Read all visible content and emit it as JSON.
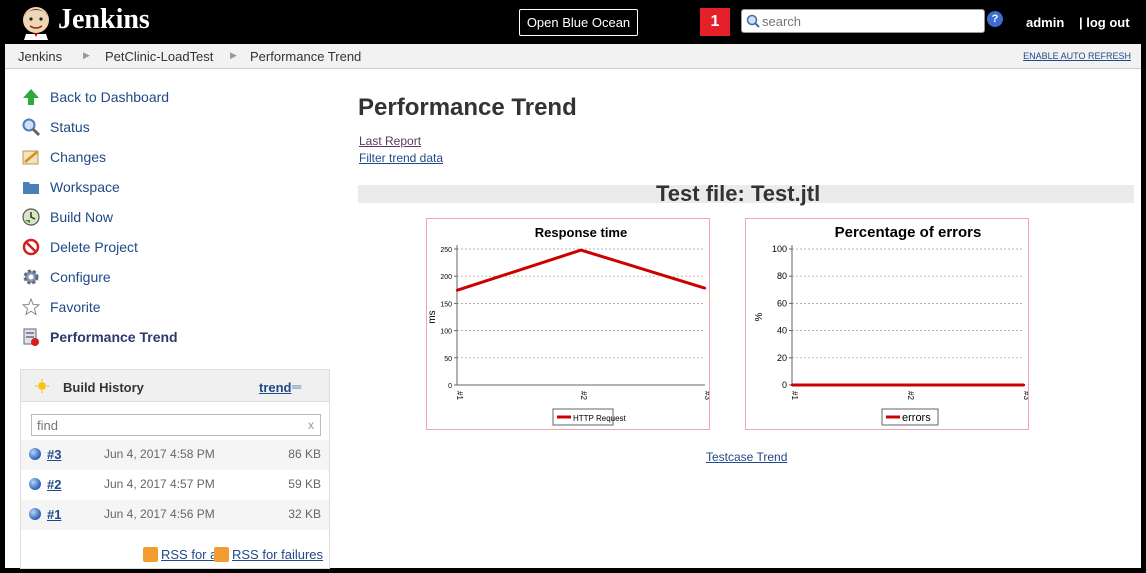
{
  "header": {
    "app_title": "Jenkins",
    "blue_ocean_label": "Open Blue Ocean",
    "notification_count": "1",
    "search_placeholder": "search",
    "help_icon": "?",
    "user": "admin",
    "logout": "| log out"
  },
  "breadcrumb": {
    "items": [
      "Jenkins",
      "PetClinic-LoadTest",
      "Performance Trend"
    ],
    "auto_refresh": "ENABLE AUTO REFRESH"
  },
  "sidebar": {
    "tasks": [
      {
        "label": "Back to Dashboard",
        "icon": "up-arrow-icon"
      },
      {
        "label": "Status",
        "icon": "magnifier-icon"
      },
      {
        "label": "Changes",
        "icon": "notepad-icon"
      },
      {
        "label": "Workspace",
        "icon": "folder-icon"
      },
      {
        "label": "Build Now",
        "icon": "clock-icon"
      },
      {
        "label": "Delete Project",
        "icon": "no-entry-icon"
      },
      {
        "label": "Configure",
        "icon": "gear-icon"
      },
      {
        "label": "Favorite",
        "icon": "star-icon"
      },
      {
        "label": "Performance Trend",
        "icon": "performance-icon"
      }
    ]
  },
  "build_history": {
    "title": "Build History",
    "trend_label": "trend",
    "trend_suffix": "═",
    "find_placeholder": "find",
    "clear": "x",
    "builds": [
      {
        "number": "#3",
        "date": "Jun 4, 2017 4:58 PM",
        "size": "86 KB"
      },
      {
        "number": "#2",
        "date": "Jun 4, 2017 4:57 PM",
        "size": "59 KB"
      },
      {
        "number": "#1",
        "date": "Jun 4, 2017 4:56 PM",
        "size": "32 KB"
      }
    ],
    "rss_all": "RSS for all",
    "rss_failures": "RSS for failures"
  },
  "main": {
    "title": "Performance Trend",
    "last_report": "Last Report",
    "filter_trend": "Filter trend data",
    "test_file": "Test file: Test.jtl",
    "testcase_trend": "Testcase Trend"
  },
  "chart_data": [
    {
      "type": "line",
      "title": "Response time",
      "xlabel": "",
      "ylabel": "ms",
      "categories": [
        "#1",
        "#2",
        "#3"
      ],
      "ylim": [
        0,
        250
      ],
      "yticks": [
        0,
        50,
        100,
        150,
        200,
        250
      ],
      "series": [
        {
          "name": "HTTP Request",
          "values": [
            174,
            248,
            178
          ],
          "color": "#cc0000"
        }
      ],
      "grid": true,
      "legend": "bottom"
    },
    {
      "type": "line",
      "title": "Percentage of errors",
      "xlabel": "",
      "ylabel": "%",
      "categories": [
        "#1",
        "#2",
        "#3"
      ],
      "ylim": [
        0,
        100
      ],
      "yticks": [
        0,
        20,
        40,
        60,
        80,
        100
      ],
      "series": [
        {
          "name": "errors",
          "values": [
            0,
            0,
            0
          ],
          "color": "#cc0000"
        }
      ],
      "grid": true,
      "legend": "bottom"
    }
  ]
}
